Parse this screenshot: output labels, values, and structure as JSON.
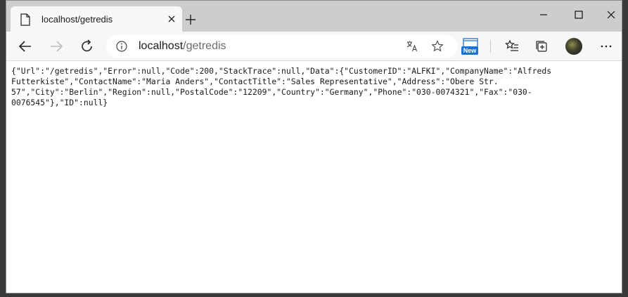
{
  "tab": {
    "title": "localhost/getredis"
  },
  "address": {
    "host": "localhost",
    "path": "/getredis"
  },
  "extension": {
    "badge": "New"
  },
  "content": {
    "json_lines": [
      "{\"Url\":\"/getredis\",\"Error\":null,\"Code\":200,\"StackTrace\":null,\"Data\":{\"CustomerID\":\"ALFKI\",\"CompanyName\":\"Alfreds",
      "Futterkiste\",\"ContactName\":\"Maria Anders\",\"ContactTitle\":\"Sales Representative\",\"Address\":\"Obere Str.",
      "57\",\"City\":\"Berlin\",\"Region\":null,\"PostalCode\":\"12209\",\"Country\":\"Germany\",\"Phone\":\"030-0074321\",\"Fax\":\"030-",
      "0076545\"},\"ID\":null}"
    ]
  }
}
